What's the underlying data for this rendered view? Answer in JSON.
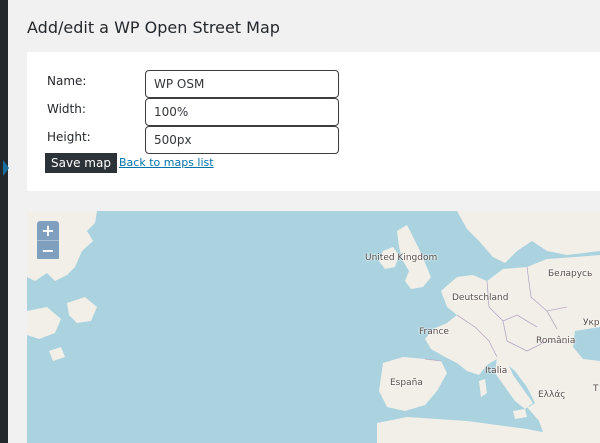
{
  "page": {
    "title": "Add/edit a WP Open Street Map"
  },
  "form": {
    "name_label": "Name:",
    "name_value": "WP OSM",
    "width_label": "Width:",
    "width_value": "100%",
    "height_label": "Height:",
    "height_value": "500px",
    "save_label": "Save map",
    "back_label": "Back to maps list"
  },
  "map": {
    "zoom_in": "+",
    "zoom_out": "−",
    "labels": {
      "united_kingdom": "United Kingdom",
      "deutschland": "Deutschland",
      "belarus": "Беларусь",
      "france": "France",
      "romania": "România",
      "ukraine": "Укр",
      "italia": "Italia",
      "espana": "España",
      "greece": "Ελλάς",
      "turkey": "T"
    },
    "colors": {
      "sea": "#aad3df",
      "land": "#f2efe9",
      "border": "#b9a8c4",
      "controls": "#7f9fbf"
    }
  }
}
